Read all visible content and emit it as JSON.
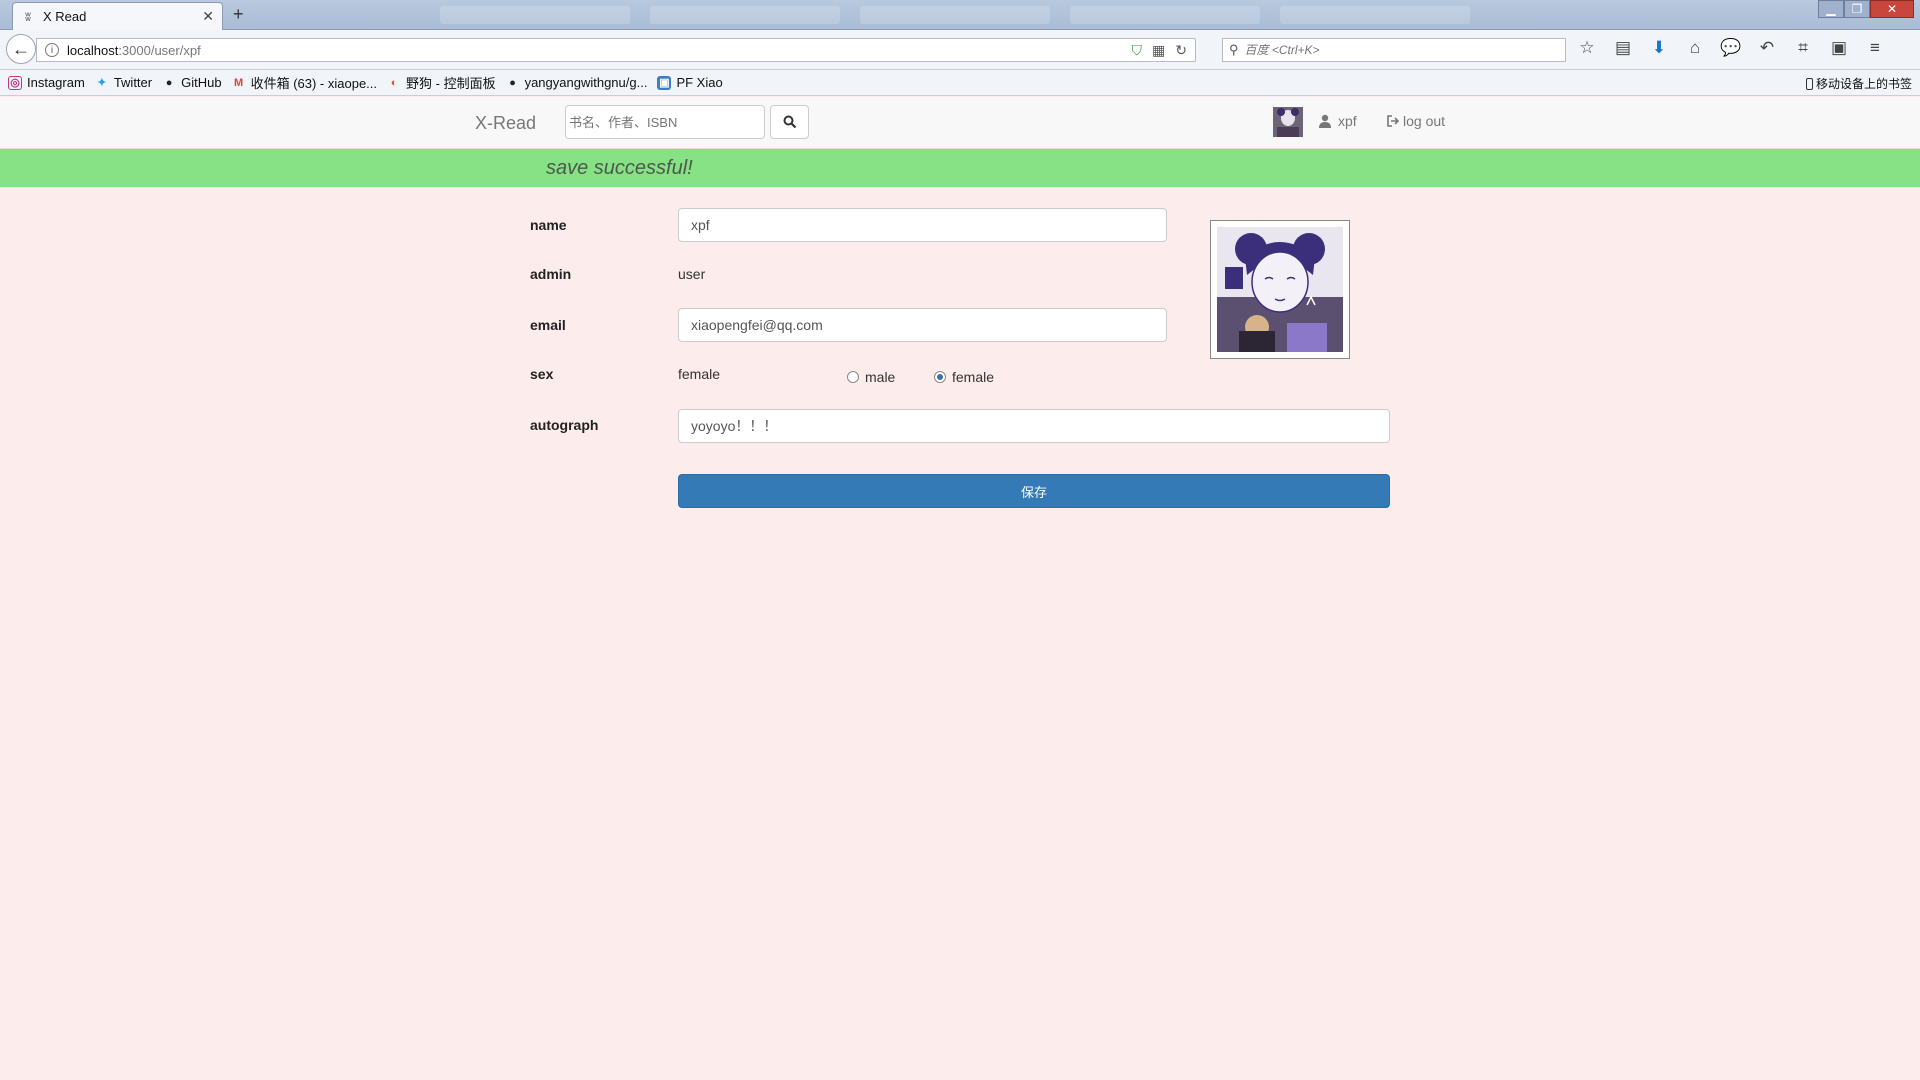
{
  "browser": {
    "tab_title": "X Read",
    "url_host": "localhost",
    "url_path": ":3000/user/xpf",
    "search_placeholder": "百度 <Ctrl+K>",
    "bookmarks": [
      {
        "label": "Instagram",
        "color": "#c13584",
        "glyph": "◎"
      },
      {
        "label": "Twitter",
        "color": "#1da1f2",
        "glyph": "✦"
      },
      {
        "label": "GitHub",
        "color": "#222222",
        "glyph": "●"
      },
      {
        "label": "收件箱 (63) - xiaope...",
        "color": "#d44638",
        "glyph": "M"
      },
      {
        "label": "野狗 - 控制面板",
        "color": "#e8541e",
        "glyph": "◐"
      },
      {
        "label": "yangyangwithgnu/g...",
        "color": "#222222",
        "glyph": "●"
      },
      {
        "label": "PF Xiao",
        "color": "#3b7ec8",
        "glyph": "▣"
      }
    ],
    "mobile_bookmarks": "移动设备上的书签"
  },
  "app": {
    "brand": "X-Read",
    "search_placeholder": "书名、作者、ISBN",
    "username": "xpf",
    "logout": "log out",
    "flash": "save successful!"
  },
  "form": {
    "name_label": "name",
    "name_value": "xpf",
    "admin_label": "admin",
    "admin_value": "user",
    "email_label": "email",
    "email_value": "xiaopengfei@qq.com",
    "sex_label": "sex",
    "sex_value": "female",
    "radio_male": "male",
    "radio_female": "female",
    "selected_sex": "female",
    "autograph_label": "autograph",
    "autograph_value": "yoyoyo！！！",
    "save_button": "保存"
  }
}
